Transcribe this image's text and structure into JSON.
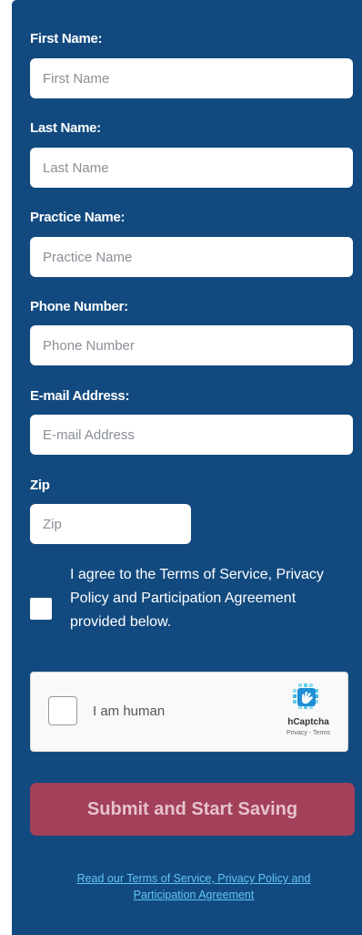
{
  "form": {
    "fields": [
      {
        "label": "First Name:",
        "placeholder": "First Name"
      },
      {
        "label": "Last Name:",
        "placeholder": "Last Name"
      },
      {
        "label": "Practice Name:",
        "placeholder": "Practice Name"
      },
      {
        "label": "Phone Number:",
        "placeholder": "Phone Number"
      },
      {
        "label": "E-mail Address:",
        "placeholder": "E-mail Address"
      },
      {
        "label": "Zip",
        "placeholder": "Zip"
      }
    ],
    "agree_text": "I agree to the Terms of Service, Privacy Policy and Participation Agreement provided below.",
    "agree_checked": false,
    "captcha": {
      "label": "I am human",
      "brand": "hCaptcha",
      "links": "Privacy - Terms"
    },
    "submit_label": "Submit and Start Saving",
    "terms_link": "Read our Terms of Service, Privacy Policy and Participation Agreement"
  },
  "colors": {
    "panel_bg": "#124a7f",
    "submit_bg": "#a3405a",
    "link": "#61c4f3"
  }
}
